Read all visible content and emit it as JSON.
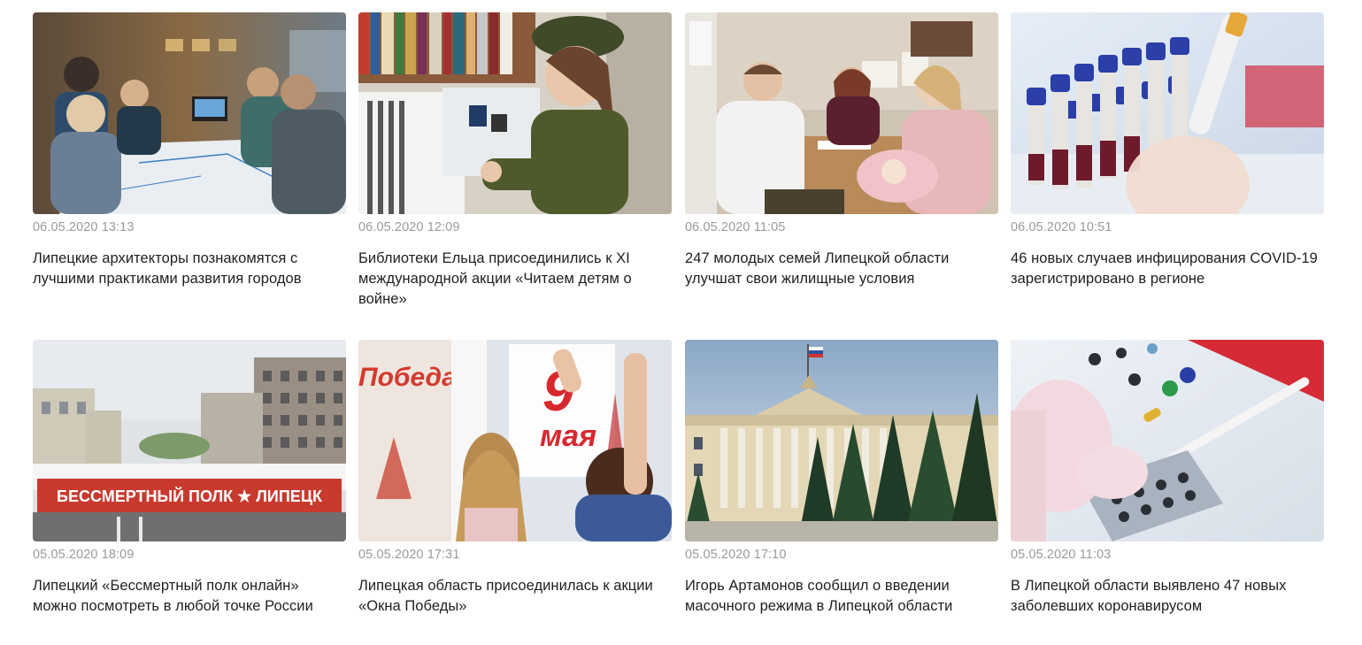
{
  "news": [
    {
      "date": "06.05.2020 13:13",
      "title": "Липецкие архитекторы познакомятся с лучшими практиками развития городов",
      "image": "architects-meeting-photo"
    },
    {
      "date": "06.05.2020 12:09",
      "title": "Библиотеки Ельца присоединились к XI международной акции «Читаем детям о войне»",
      "image": "girl-reading-library-photo"
    },
    {
      "date": "06.05.2020 11:05",
      "title": "247 молодых семей Липецкой области улучшат свои жилищные условия",
      "image": "young-family-office-photo"
    },
    {
      "date": "06.05.2020 10:51",
      "title": "46 новых случаев инфицирования COVID-19 зарегистрировано в регионе",
      "image": "lab-test-tubes-photo"
    },
    {
      "date": "05.05.2020 18:09",
      "title": "Липецкий «Бессмертный полк онлайн» можно посмотреть в любой точке России",
      "image": "immortal-regiment-march-photo",
      "banner_text": "БЕССМЕРТНЫЙ ПОЛК ★ ЛИПЕЦК"
    },
    {
      "date": "05.05.2020 17:31",
      "title": "Липецкая область присоединилась к акции «Окна Победы»",
      "image": "children-window-poster-photo",
      "poster_text_left": "Победа",
      "poster_text_right_number": "9",
      "poster_text_right_word": "мая"
    },
    {
      "date": "05.05.2020 17:10",
      "title": "Игорь Артамонов сообщил о введении масочного режима в Липецкой области",
      "image": "administration-building-photo"
    },
    {
      "date": "05.05.2020 11:03",
      "title": "В Липецкой области выявлено 47 новых заболевших коронавирусом",
      "image": "lab-pipette-photo"
    }
  ],
  "colors": {
    "date": "#9a9a9a",
    "title": "#1f1f1f",
    "background": "#ffffff"
  }
}
